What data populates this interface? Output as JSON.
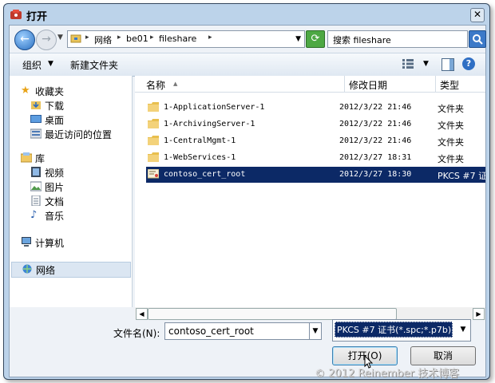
{
  "window": {
    "title": "打开",
    "close_glyph": "✕"
  },
  "nav": {
    "breadcrumbs": [
      "网络",
      "be01",
      "fileshare"
    ],
    "search_placeholder": "搜索 fileshare"
  },
  "toolbar": {
    "organize_label": "组织",
    "new_folder_label": "新建文件夹",
    "help_glyph": "?"
  },
  "sidebar": {
    "items": [
      {
        "label": "收藏夹",
        "icon": "star-icon"
      },
      {
        "label": "下载",
        "icon": "download-folder-icon"
      },
      {
        "label": "桌面",
        "icon": "desktop-icon"
      },
      {
        "label": "最近访问的位置",
        "icon": "recent-places-icon"
      },
      {
        "label": "库",
        "icon": "library-icon"
      },
      {
        "label": "视频",
        "icon": "video-icon"
      },
      {
        "label": "图片",
        "icon": "pictures-icon"
      },
      {
        "label": "文档",
        "icon": "documents-icon"
      },
      {
        "label": "音乐",
        "icon": "music-icon"
      },
      {
        "label": "计算机",
        "icon": "computer-icon"
      },
      {
        "label": "网络",
        "icon": "network-icon",
        "selected": true
      }
    ]
  },
  "file_list": {
    "columns": [
      "名称",
      "修改日期",
      "类型"
    ],
    "rows": [
      {
        "name": "1-ApplicationServer-1",
        "date": "2012/3/22 21:46",
        "type": "文件夹",
        "icon": "folder-icon"
      },
      {
        "name": "1-ArchivingServer-1",
        "date": "2012/3/22 21:46",
        "type": "文件夹",
        "icon": "folder-icon"
      },
      {
        "name": "1-CentralMgmt-1",
        "date": "2012/3/22 21:46",
        "type": "文件夹",
        "icon": "folder-icon"
      },
      {
        "name": "1-WebServices-1",
        "date": "2012/3/27 18:31",
        "type": "文件夹",
        "icon": "folder-icon"
      },
      {
        "name": "contoso_cert_root",
        "date": "2012/3/27 18:30",
        "type": "PKCS #7 证",
        "icon": "certificate-icon",
        "selected": true
      }
    ]
  },
  "bottom": {
    "filename_label": "文件名(N):",
    "filename_value": "contoso_cert_root",
    "filetype_value": "PKCS #7 证书(*.spc;*.p7b)",
    "open_label": "打开(O)",
    "cancel_label": "取消"
  },
  "watermark": "© 2012 Reinember 技术博客",
  "colors": {
    "selection": "#0c2966",
    "frame": "#bcd3ea"
  }
}
